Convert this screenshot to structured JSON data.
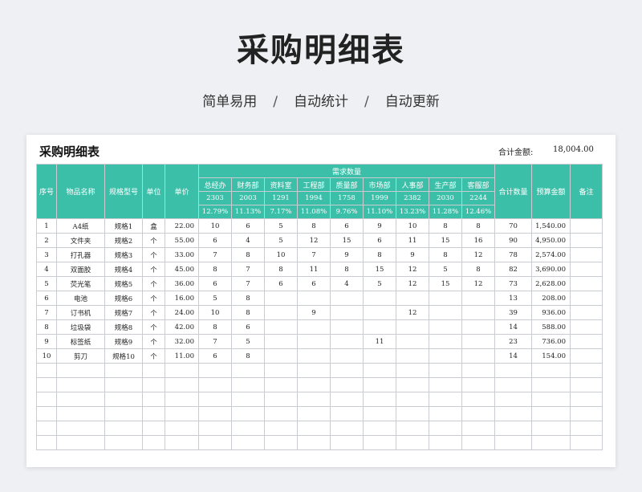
{
  "page": {
    "title": "采购明细表",
    "features": [
      "简单易用",
      "自动统计",
      "自动更新"
    ],
    "separator": "/"
  },
  "sheet": {
    "title": "采购明细表",
    "total_label": "合计金额:",
    "total_value": "18,004.00",
    "headers": {
      "no": "序号",
      "name": "物品名称",
      "spec": "规格型号",
      "unit": "单位",
      "price": "单价",
      "demand": "需求数量",
      "total_qty": "合计数量",
      "amount": "预算金额",
      "remark": "备注"
    },
    "departments": [
      {
        "name": "总经办",
        "count": "2303",
        "pct": "12.79%"
      },
      {
        "name": "财务部",
        "count": "2003",
        "pct": "11.13%"
      },
      {
        "name": "资料室",
        "count": "1291",
        "pct": "7.17%"
      },
      {
        "name": "工程部",
        "count": "1994",
        "pct": "11.08%"
      },
      {
        "name": "质量部",
        "count": "1758",
        "pct": "9.76%"
      },
      {
        "name": "市场部",
        "count": "1999",
        "pct": "11.10%"
      },
      {
        "name": "人事部",
        "count": "2382",
        "pct": "13.23%"
      },
      {
        "name": "生产部",
        "count": "2030",
        "pct": "11.28%"
      },
      {
        "name": "客服部",
        "count": "2244",
        "pct": "12.46%"
      }
    ],
    "rows": [
      {
        "no": "1",
        "name": "A4纸",
        "spec": "规格1",
        "unit": "盒",
        "price": "22.00",
        "q": [
          "10",
          "6",
          "5",
          "8",
          "6",
          "9",
          "10",
          "8",
          "8"
        ],
        "total": "70",
        "amount": "1,540.00",
        "remark": ""
      },
      {
        "no": "2",
        "name": "文件夹",
        "spec": "规格2",
        "unit": "个",
        "price": "55.00",
        "q": [
          "6",
          "4",
          "5",
          "12",
          "15",
          "6",
          "11",
          "15",
          "16"
        ],
        "total": "90",
        "amount": "4,950.00",
        "remark": ""
      },
      {
        "no": "3",
        "name": "打孔器",
        "spec": "规格3",
        "unit": "个",
        "price": "33.00",
        "q": [
          "7",
          "8",
          "10",
          "7",
          "9",
          "8",
          "9",
          "8",
          "12"
        ],
        "total": "78",
        "amount": "2,574.00",
        "remark": ""
      },
      {
        "no": "4",
        "name": "双面胶",
        "spec": "规格4",
        "unit": "个",
        "price": "45.00",
        "q": [
          "8",
          "7",
          "8",
          "11",
          "8",
          "15",
          "12",
          "5",
          "8"
        ],
        "total": "82",
        "amount": "3,690.00",
        "remark": ""
      },
      {
        "no": "5",
        "name": "荧光笔",
        "spec": "规格5",
        "unit": "个",
        "price": "36.00",
        "q": [
          "6",
          "7",
          "6",
          "6",
          "4",
          "5",
          "12",
          "15",
          "12"
        ],
        "total": "73",
        "amount": "2,628.00",
        "remark": ""
      },
      {
        "no": "6",
        "name": "电池",
        "spec": "规格6",
        "unit": "个",
        "price": "16.00",
        "q": [
          "5",
          "8",
          "",
          "",
          "",
          "",
          "",
          "",
          ""
        ],
        "total": "13",
        "amount": "208.00",
        "remark": ""
      },
      {
        "no": "7",
        "name": "订书机",
        "spec": "规格7",
        "unit": "个",
        "price": "24.00",
        "q": [
          "10",
          "8",
          "",
          "9",
          "",
          "",
          "12",
          "",
          ""
        ],
        "total": "39",
        "amount": "936.00",
        "remark": ""
      },
      {
        "no": "8",
        "name": "垃圾袋",
        "spec": "规格8",
        "unit": "个",
        "price": "42.00",
        "q": [
          "8",
          "6",
          "",
          "",
          "",
          "",
          "",
          "",
          ""
        ],
        "total": "14",
        "amount": "588.00",
        "remark": ""
      },
      {
        "no": "9",
        "name": "标签纸",
        "spec": "规格9",
        "unit": "个",
        "price": "32.00",
        "q": [
          "7",
          "5",
          "",
          "",
          "",
          "11",
          "",
          "",
          ""
        ],
        "total": "23",
        "amount": "736.00",
        "remark": ""
      },
      {
        "no": "10",
        "name": "剪刀",
        "spec": "规格10",
        "unit": "个",
        "price": "11.00",
        "q": [
          "6",
          "8",
          "",
          "",
          "",
          "",
          "",
          "",
          ""
        ],
        "total": "14",
        "amount": "154.00",
        "remark": ""
      }
    ]
  }
}
